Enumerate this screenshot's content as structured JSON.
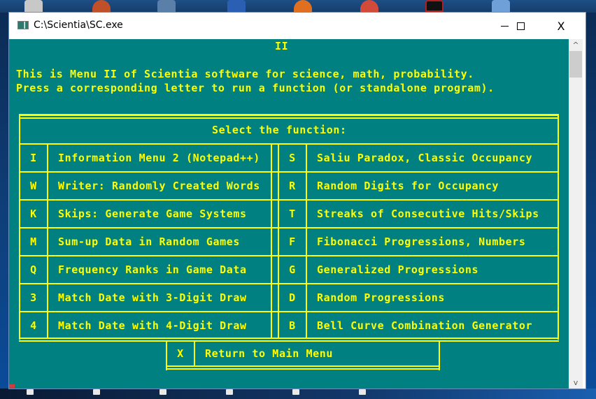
{
  "desktop": {
    "top_icons": [
      {
        "name": "gear-app-icon",
        "color": "#c8c8c8"
      },
      {
        "name": "orange-app-icon",
        "color": "#c0502a"
      },
      {
        "name": "document-app-icon",
        "color": "#5a7fa8"
      },
      {
        "name": "word-icon",
        "color": "#2b5fb3"
      },
      {
        "name": "firefox-icon",
        "color": "#e07020"
      },
      {
        "name": "chrome-icon",
        "color": "#d24a3a"
      },
      {
        "name": "red-app-icon",
        "color": "#b02020"
      },
      {
        "name": "settings-app-icon",
        "color": "#6fa0d8"
      }
    ]
  },
  "window": {
    "title": "C:\\Scientia\\SC.exe",
    "controls": {
      "minimize": "minimize",
      "maximize": "maximize",
      "close": "X"
    }
  },
  "console": {
    "menu_id": "II",
    "intro_line1": "This is Menu II of Scientia software for science, math, probability.",
    "intro_line2": "Press a corresponding letter to run a function (or standalone program).",
    "table_header": "Select the function:",
    "left_items": [
      {
        "key": "I",
        "label": "Information Menu 2 (Notepad++)"
      },
      {
        "key": "W",
        "label": "Writer: Randomly Created Words"
      },
      {
        "key": "K",
        "label": "Skips: Generate Game Systems"
      },
      {
        "key": "M",
        "label": "Sum-up Data in Random Games"
      },
      {
        "key": "Q",
        "label": "Frequency Ranks in Game Data"
      },
      {
        "key": "3",
        "label": "Match Date with 3-Digit Draw"
      },
      {
        "key": "4",
        "label": "Match Date with 4-Digit Draw"
      }
    ],
    "right_items": [
      {
        "key": "S",
        "label": "Saliu Paradox, Classic Occupancy"
      },
      {
        "key": "R",
        "label": "Random Digits for Occupancy"
      },
      {
        "key": "T",
        "label": "Streaks of Consecutive Hits/Skips"
      },
      {
        "key": "F",
        "label": "Fibonacci Progressions, Numbers"
      },
      {
        "key": "G",
        "label": "Generalized Progressions"
      },
      {
        "key": "D",
        "label": "Random Progressions"
      },
      {
        "key": "B",
        "label": "Bell Curve Combination Generator"
      }
    ],
    "return_item": {
      "key": "X",
      "label": "Return to Main Menu"
    }
  },
  "scrollbar": {
    "up": "^",
    "down": "v"
  },
  "colors": {
    "console_bg": "#008080",
    "console_fg": "#ffff00"
  }
}
